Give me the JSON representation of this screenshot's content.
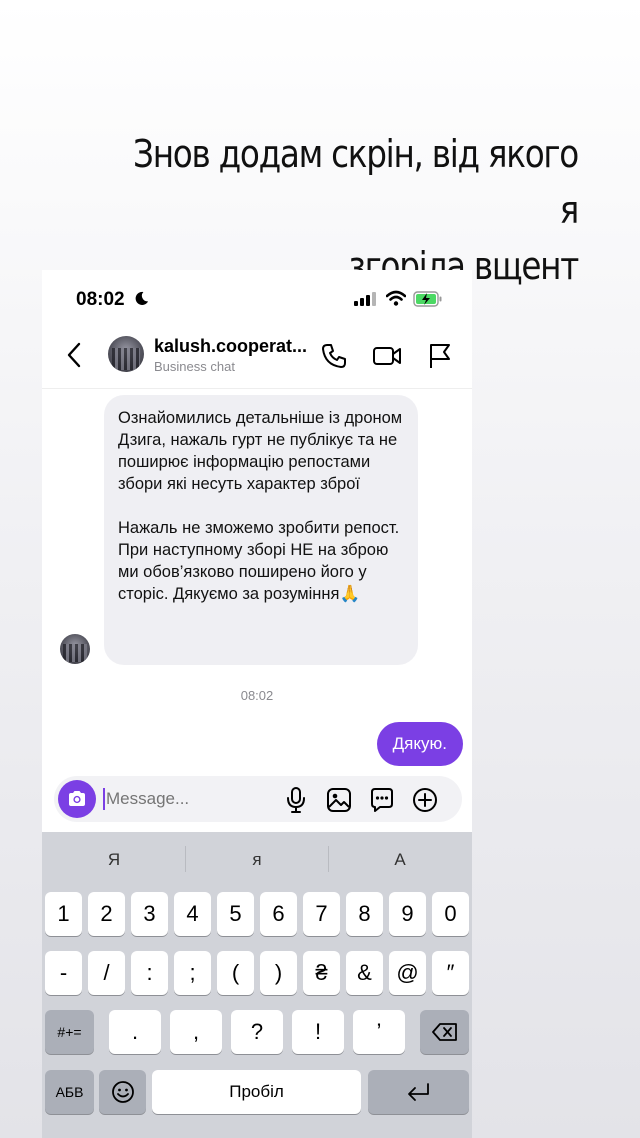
{
  "caption": {
    "line1": "Знов додам скрін, від якого я",
    "line2": "згоріла вщент"
  },
  "status_bar": {
    "time": "08:02"
  },
  "chat_header": {
    "name": "kalush.cooperat...",
    "subtitle": "Business chat"
  },
  "messages": {
    "incoming_p1": "Ознайомились детальніше із дроном Дзига, нажаль гурт не публікує та не поширює інформацію репостами збори які несуть характер зброї",
    "incoming_p2": "Нажаль не зможемо зробити репост. При наступному зборі НЕ на зброю ми обов’язково поширено його у сторіс. Дякуємо за розуміння🙏",
    "timestamp": "08:02",
    "outgoing": "Дякую."
  },
  "composer": {
    "placeholder": "Message..."
  },
  "keyboard": {
    "suggestions": [
      "Я",
      "я",
      "А"
    ],
    "row1": [
      "1",
      "2",
      "3",
      "4",
      "5",
      "6",
      "7",
      "8",
      "9",
      "0"
    ],
    "row2": [
      "-",
      "/",
      ":",
      ";",
      "(",
      ")",
      "₴",
      "&",
      "@",
      "″"
    ],
    "row3": [
      ".",
      ",",
      "?",
      "!",
      "’"
    ],
    "mode_key": "#+=",
    "lang_key": "АБВ",
    "space": "Пробіл"
  },
  "colors": {
    "accent": "#7b3fe4",
    "incoming_bubble": "#efeff3",
    "keyboard_bg": "#d1d3d9"
  }
}
